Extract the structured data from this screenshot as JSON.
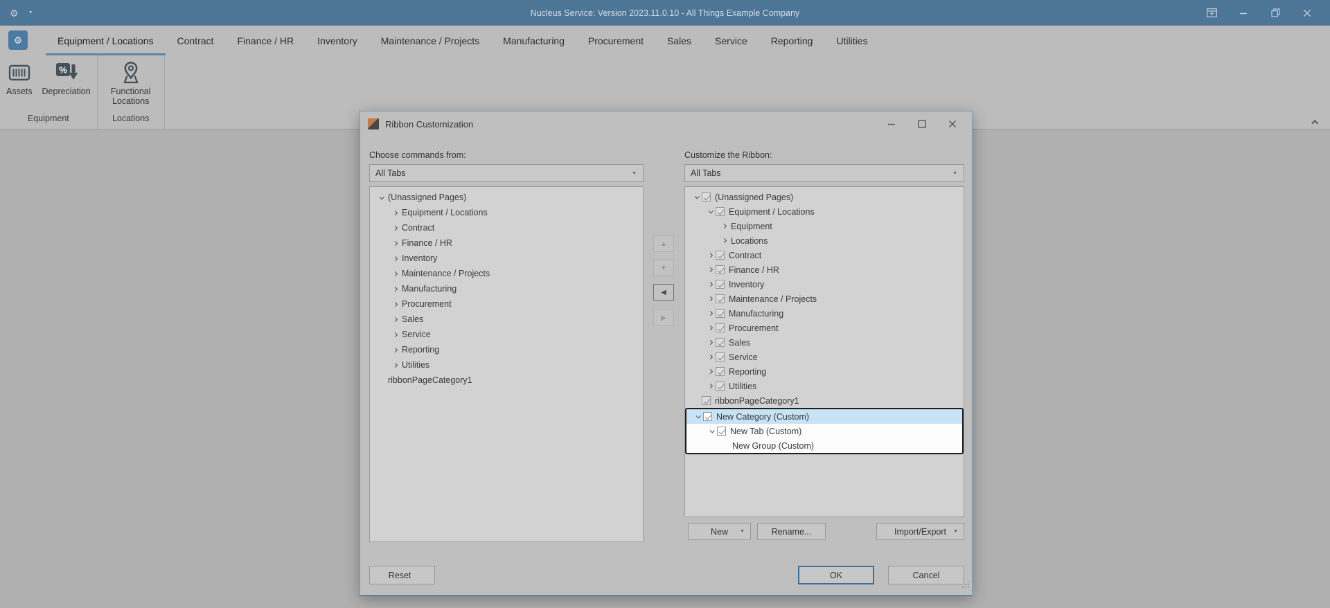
{
  "colors": {
    "titlebar": "#4d7596",
    "accent_underline": "#5b87aa",
    "selection": "#c8e2f6",
    "dialog_border": "#7b9cb5"
  },
  "titlebar": {
    "title": "Nucleus Service: Version 2023.11.0.10 - All Things Example Company",
    "qat_icon": "gear-icon",
    "qat_gear_glyph": "⚙",
    "window_controls": [
      "ribbon-display-options-icon",
      "minimize-icon",
      "restore-icon",
      "close-icon"
    ]
  },
  "ribbon": {
    "app_button_icon": "gear-icon",
    "app_button_glyph": "⚙",
    "tabs": [
      {
        "label": "Equipment / Locations",
        "active": true
      },
      {
        "label": "Contract",
        "active": false
      },
      {
        "label": "Finance / HR",
        "active": false
      },
      {
        "label": "Inventory",
        "active": false
      },
      {
        "label": "Maintenance / Projects",
        "active": false
      },
      {
        "label": "Manufacturing",
        "active": false
      },
      {
        "label": "Procurement",
        "active": false
      },
      {
        "label": "Sales",
        "active": false
      },
      {
        "label": "Service",
        "active": false
      },
      {
        "label": "Reporting",
        "active": false
      },
      {
        "label": "Utilities",
        "active": false
      }
    ],
    "groups": [
      {
        "label": "Equipment",
        "buttons": [
          {
            "label": "Assets",
            "icon": "barcode-icon"
          },
          {
            "label": "Depreciation",
            "icon": "percent-down-arrow-icon"
          }
        ]
      },
      {
        "label": "Locations",
        "buttons": [
          {
            "label": "Functional Locations",
            "icon": "map-pin-icon"
          }
        ]
      }
    ],
    "collapse_button_icon": "chevron-up-icon"
  },
  "dialog": {
    "title": "Ribbon Customization",
    "title_icon": "ribbon-customization-icon",
    "window_controls": [
      "minimize-icon",
      "maximize-icon",
      "close-icon"
    ],
    "left_panel": {
      "label": "Choose commands from:",
      "combo_value": "All Tabs",
      "tree": [
        {
          "text": "(Unassigned Pages)",
          "level": 0,
          "expander": "expanded"
        },
        {
          "text": "Equipment / Locations",
          "level": 1,
          "expander": "collapsed"
        },
        {
          "text": "Contract",
          "level": 1,
          "expander": "collapsed"
        },
        {
          "text": "Finance / HR",
          "level": 1,
          "expander": "collapsed"
        },
        {
          "text": "Inventory",
          "level": 1,
          "expander": "collapsed"
        },
        {
          "text": "Maintenance / Projects",
          "level": 1,
          "expander": "collapsed"
        },
        {
          "text": "Manufacturing",
          "level": 1,
          "expander": "collapsed"
        },
        {
          "text": "Procurement",
          "level": 1,
          "expander": "collapsed"
        },
        {
          "text": "Sales",
          "level": 1,
          "expander": "collapsed"
        },
        {
          "text": "Service",
          "level": 1,
          "expander": "collapsed"
        },
        {
          "text": "Reporting",
          "level": 1,
          "expander": "collapsed"
        },
        {
          "text": "Utilities",
          "level": 1,
          "expander": "collapsed"
        },
        {
          "text": "ribbonPageCategory1",
          "level": 0,
          "expander": "none"
        }
      ]
    },
    "transfer_buttons": [
      {
        "name": "move-up",
        "glyph": "▲",
        "enabled": false
      },
      {
        "name": "move-down",
        "glyph": "▼",
        "enabled": false
      },
      {
        "name": "move-left",
        "glyph": "◀",
        "enabled": true
      },
      {
        "name": "move-right",
        "glyph": "▶",
        "enabled": false
      }
    ],
    "right_panel": {
      "label": "Customize the Ribbon:",
      "combo_value": "All Tabs",
      "tree": [
        {
          "text": "(Unassigned Pages)",
          "level": 0,
          "expander": "expanded",
          "checkbox": "checked"
        },
        {
          "text": "Equipment / Locations",
          "level": 1,
          "expander": "expanded",
          "checkbox": "checked"
        },
        {
          "text": "Equipment",
          "level": 2,
          "expander": "collapsed"
        },
        {
          "text": "Locations",
          "level": 2,
          "expander": "collapsed"
        },
        {
          "text": "Contract",
          "level": 1,
          "expander": "collapsed",
          "checkbox": "checked"
        },
        {
          "text": "Finance / HR",
          "level": 1,
          "expander": "collapsed",
          "checkbox": "checked"
        },
        {
          "text": "Inventory",
          "level": 1,
          "expander": "collapsed",
          "checkbox": "checked"
        },
        {
          "text": "Maintenance / Projects",
          "level": 1,
          "expander": "collapsed",
          "checkbox": "checked"
        },
        {
          "text": "Manufacturing",
          "level": 1,
          "expander": "collapsed",
          "checkbox": "checked"
        },
        {
          "text": "Procurement",
          "level": 1,
          "expander": "collapsed",
          "checkbox": "checked"
        },
        {
          "text": "Sales",
          "level": 1,
          "expander": "collapsed",
          "checkbox": "checked"
        },
        {
          "text": "Service",
          "level": 1,
          "expander": "collapsed",
          "checkbox": "checked"
        },
        {
          "text": "Reporting",
          "level": 1,
          "expander": "collapsed",
          "checkbox": "checked"
        },
        {
          "text": "Utilities",
          "level": 1,
          "expander": "collapsed",
          "checkbox": "checked"
        },
        {
          "text": "ribbonPageCategory1",
          "level": 0,
          "expander": "none",
          "checkbox": "checked"
        },
        {
          "text": "New Category (Custom)",
          "level": 0,
          "expander": "expanded",
          "checkbox": "checked",
          "selected": true,
          "framed": true
        },
        {
          "text": "New Tab (Custom)",
          "level": 1,
          "expander": "expanded",
          "checkbox": "checked",
          "framed": true
        },
        {
          "text": "New Group (Custom)",
          "level": 2,
          "expander": "none",
          "framed": true
        }
      ],
      "buttons": [
        {
          "label": "New",
          "dropdown": true
        },
        {
          "label": "Rename...",
          "dropdown": false
        },
        {
          "label": "Import/Export",
          "dropdown": true
        }
      ]
    },
    "footer": {
      "reset_label": "Reset",
      "reset_dropdown": true,
      "ok_label": "OK",
      "cancel_label": "Cancel"
    }
  }
}
